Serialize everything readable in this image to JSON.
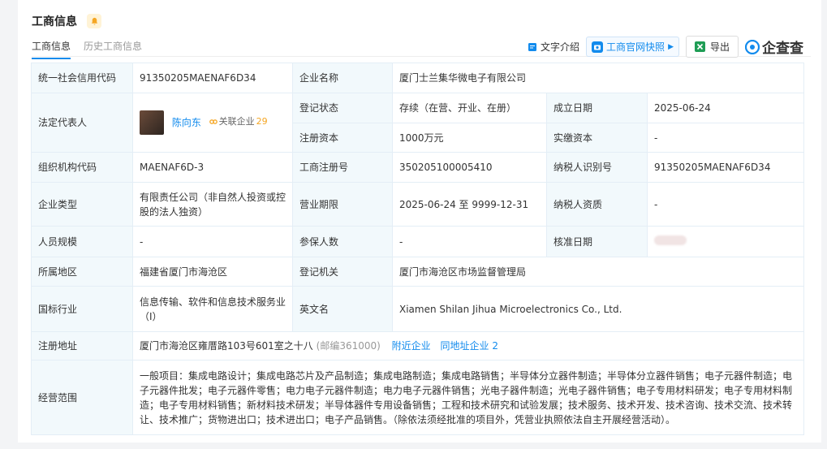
{
  "header": {
    "title": "工商信息"
  },
  "tabs": [
    {
      "label": "工商信息"
    },
    {
      "label": "历史工商信息"
    }
  ],
  "toolbar": {
    "intro": "文字介绍",
    "snapshot": "工商官网快照",
    "export": "导出",
    "logo": "企查查"
  },
  "table": {
    "credit_code_label": "统一社会信用代码",
    "credit_code": "91350205MAENAF6D34",
    "company_name_label": "企业名称",
    "company_name": "厦门士兰集华微电子有限公司",
    "legal_rep_label": "法定代表人",
    "legal_rep_name": "陈向东",
    "related_label": "关联企业",
    "related_count": "29",
    "reg_status_label": "登记状态",
    "reg_status": "存续（在营、开业、在册）",
    "found_date_label": "成立日期",
    "found_date": "2025-06-24",
    "reg_capital_label": "注册资本",
    "reg_capital": "1000万元",
    "paid_capital_label": "实缴资本",
    "paid_capital": "-",
    "org_code_label": "组织机构代码",
    "org_code": "MAENAF6D-3",
    "biz_reg_no_label": "工商注册号",
    "biz_reg_no": "350205100005410",
    "tax_id_label": "纳税人识别号",
    "tax_id": "91350205MAENAF6D34",
    "type_label": "企业类型",
    "type_value": "有限责任公司（非自然人投资或控股的法人独资）",
    "term_label": "营业期限",
    "term_value": "2025-06-24 至 9999-12-31",
    "taxpayer_label": "纳税人资质",
    "taxpayer_value": "-",
    "staff_size_label": "人员规模",
    "staff_size": "-",
    "insured_label": "参保人数",
    "insured": "-",
    "approval_label": "核准日期",
    "region_label": "所属地区",
    "region": "福建省厦门市海沧区",
    "authority_label": "登记机关",
    "authority": "厦门市海沧区市场监督管理局",
    "industry_label": "国标行业",
    "industry": "信息传输、软件和信息技术服务业（I）",
    "en_name_label": "英文名",
    "en_name": "Xiamen Shilan Jihua Microelectronics Co., Ltd.",
    "address_label": "注册地址",
    "address": "厦门市海沧区雍厝路103号601室之十八",
    "postcode": "(邮编361000)",
    "nearby_label": "附近企业",
    "same_addr_label": "同地址企业 2",
    "scope_label": "经营范围",
    "scope": "一般项目：集成电路设计；集成电路芯片及产品制造；集成电路制造；集成电路销售；半导体分立器件制造；半导体分立器件销售；电子元器件制造；电子元器件批发；电子元器件零售；电力电子元器件制造；电力电子元器件销售；光电子器件制造；光电子器件销售；电子专用材料研发；电子专用材料制造；电子专用材料销售；新材料技术研发；半导体器件专用设备销售；工程和技术研究和试验发展；技术服务、技术开发、技术咨询、技术交流、技术转让、技术推广；货物进出口；技术进出口；电子产品销售。（除依法须经批准的项目外，凭营业执照依法自主开展经营活动）。"
  }
}
